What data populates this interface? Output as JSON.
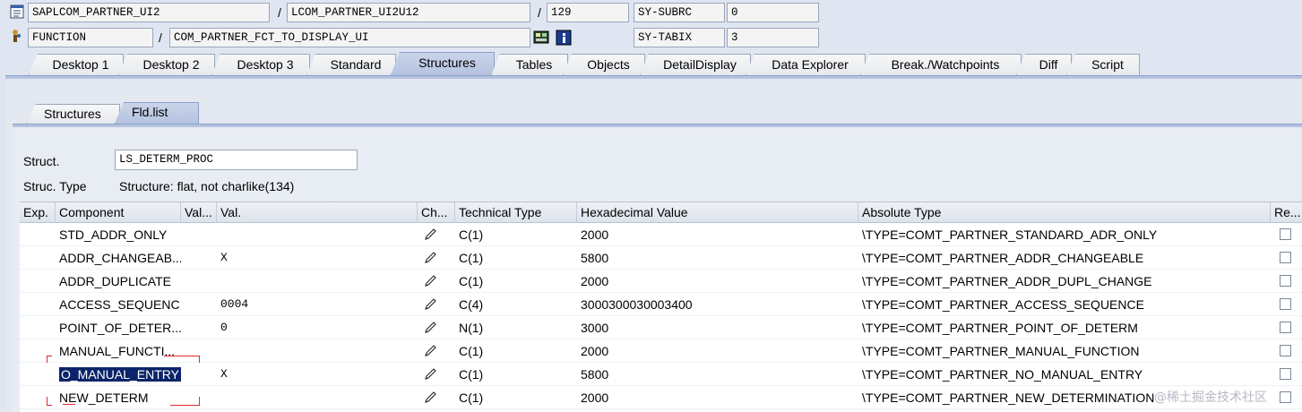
{
  "header": {
    "program": "SAPLCOM_PARTNER_UI2",
    "include": "LCOM_PARTNER_UI2U12",
    "line": "129",
    "event_type": "FUNCTION",
    "event_name": "COM_PARTNER_FCT_TO_DISPLAY_UI",
    "var1_name": "SY-SUBRC",
    "var1_value": "0",
    "var2_name": "SY-TABIX",
    "var2_value": "3",
    "slash": "/"
  },
  "tabs": [
    {
      "label": "Desktop 1"
    },
    {
      "label": "Desktop 2"
    },
    {
      "label": "Desktop 3"
    },
    {
      "label": "Standard"
    },
    {
      "label": "Structures"
    },
    {
      "label": "Tables"
    },
    {
      "label": "Objects"
    },
    {
      "label": "DetailDisplay"
    },
    {
      "label": "Data Explorer"
    },
    {
      "label": "Break./Watchpoints"
    },
    {
      "label": "Diff"
    },
    {
      "label": "Script"
    }
  ],
  "subtabs": [
    {
      "label": "Structures"
    },
    {
      "label": "Fld.list"
    }
  ],
  "struct": {
    "label": "Struct.",
    "value": "LS_DETERM_PROC",
    "type_label": "Struc. Type",
    "type_value": "Structure: flat, not charlike(134)"
  },
  "table": {
    "columns": [
      "Exp.",
      "Component",
      "Val...",
      "Val.",
      "Ch...",
      "Technical Type",
      "Hexadecimal Value",
      "Absolute Type",
      "Re..."
    ],
    "rows": [
      {
        "component": "STD_ADDR_ONLY",
        "val": "",
        "type": "C(1)",
        "hex": "2000",
        "abs": "\\TYPE=COMT_PARTNER_STANDARD_ADR_ONLY"
      },
      {
        "component": "ADDR_CHANGEAB...",
        "val": "X",
        "type": "C(1)",
        "hex": "5800",
        "abs": "\\TYPE=COMT_PARTNER_ADDR_CHANGEABLE"
      },
      {
        "component": "ADDR_DUPLICATE",
        "val": "",
        "type": "C(1)",
        "hex": "2000",
        "abs": "\\TYPE=COMT_PARTNER_ADDR_DUPL_CHANGE"
      },
      {
        "component": "ACCESS_SEQUENC...",
        "val": "0004",
        "type": "C(4)",
        "hex": "3000300030003400",
        "abs": "\\TYPE=COMT_PARTNER_ACCESS_SEQUENCE"
      },
      {
        "component": "POINT_OF_DETER...",
        "val": "0",
        "type": "N(1)",
        "hex": "3000",
        "abs": "\\TYPE=COMT_PARTNER_POINT_OF_DETERM"
      },
      {
        "component": "MANUAL_FUNCTI...",
        "val": "",
        "type": "C(1)",
        "hex": "2000",
        "abs": "\\TYPE=COMT_PARTNER_MANUAL_FUNCTION"
      },
      {
        "component": "O_MANUAL_ENTRY",
        "val": "X",
        "type": "C(1)",
        "hex": "5800",
        "abs": "\\TYPE=COMT_PARTNER_NO_MANUAL_ENTRY"
      },
      {
        "component": "NEW_DETERM",
        "val": "",
        "type": "C(1)",
        "hex": "2000",
        "abs": "\\TYPE=COMT_PARTNER_NEW_DETERMINATION"
      }
    ]
  },
  "watermark": "@稀土掘金技术社区",
  "colors": {
    "accent": "#b5c3df",
    "selection": "#0a246a",
    "annotation": "#e0282c"
  },
  "icons": [
    "program-icon",
    "function-module-icon",
    "display-icon",
    "info-icon",
    "pencil-icon"
  ]
}
